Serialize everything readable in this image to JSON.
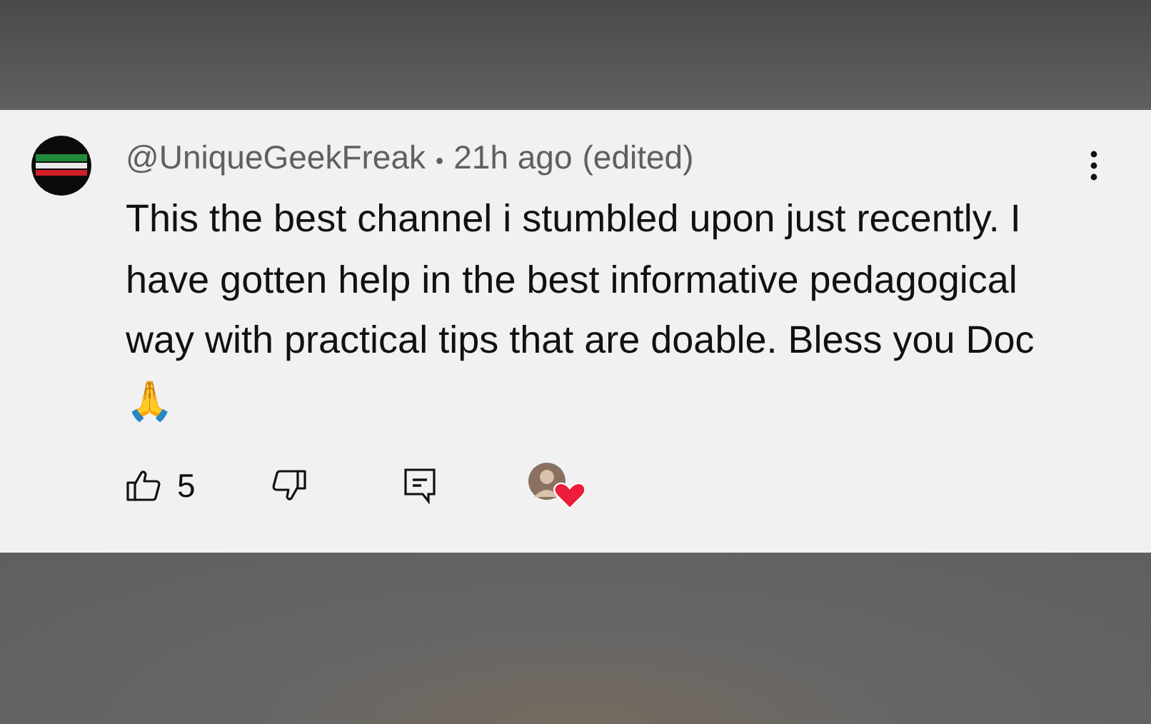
{
  "comment": {
    "author": "@UniqueGeekFreak",
    "separator": "•",
    "time": "21h ago",
    "edited_label": "(edited)",
    "text": "This the best channel i stumbled upon just recently. I have gotten help in the best informative pedagogical way with practical tips that are doable. Bless you Doc 🙏",
    "likes": "5",
    "hearted_by_creator": true
  }
}
